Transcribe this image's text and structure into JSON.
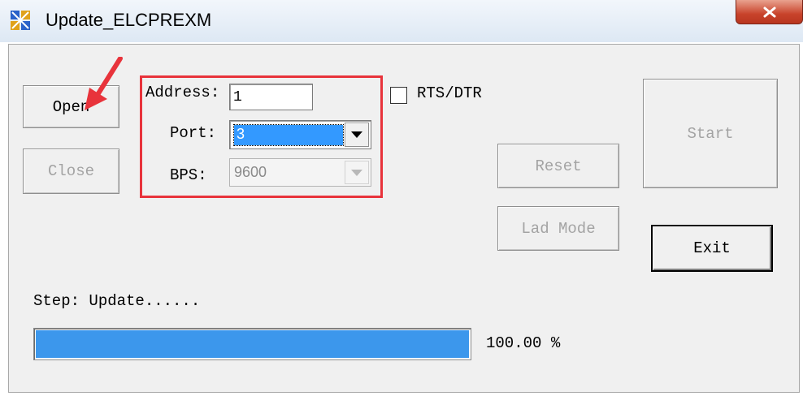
{
  "window": {
    "title": "Update_ELCPREXM",
    "app_icon": "app-grid-icon",
    "close_icon": "close-x-icon"
  },
  "buttons": {
    "open": "Open",
    "close": "Close",
    "reset": "Reset",
    "lad_mode": "Lad Mode",
    "start": "Start",
    "exit": "Exit"
  },
  "settings": {
    "address_label": "Address:",
    "address_value": "1",
    "port_label": "Port:",
    "port_value": "3",
    "bps_label": "BPS:",
    "bps_value": "9600",
    "rts_dtr_label": "RTS/DTR",
    "rts_dtr_checked": false
  },
  "status": {
    "step_text": "Step: Update......",
    "progress_percent": 100.0,
    "progress_text": "100.00 %"
  },
  "annotation": {
    "highlight_color": "#e8333b",
    "arrow_color": "#e8333b"
  },
  "colors": {
    "progress_fill": "#3c97ec",
    "selection": "#3399ff"
  }
}
